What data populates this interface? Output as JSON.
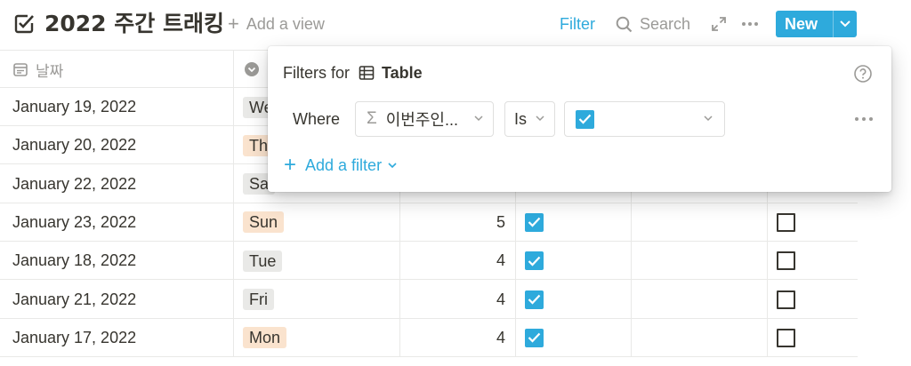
{
  "header": {
    "title": "2022 주간 트래킹",
    "add_view_label": "Add a view",
    "filter_label": "Filter",
    "search_label": "Search",
    "new_label": "New",
    "accent_color": "#2eaadc"
  },
  "table": {
    "columns": [
      {
        "label": "날짜",
        "icon": "calendar-icon"
      },
      {
        "label": "",
        "icon": "select-icon"
      }
    ],
    "rows": [
      {
        "date": "January 19, 2022",
        "day": "We",
        "day_color": "#e9e9e7",
        "count": "",
        "checked": null,
        "box": null
      },
      {
        "date": "January 20, 2022",
        "day": "Th",
        "day_color": "#fae3ce",
        "count": "",
        "checked": null,
        "box": null
      },
      {
        "date": "January 22, 2022",
        "day": "Sa",
        "day_color": "#e9e9e7",
        "count": "",
        "checked": null,
        "box": null
      },
      {
        "date": "January 23, 2022",
        "day": "Sun",
        "day_color": "#fae3ce",
        "count": "5",
        "checked": true,
        "box": false
      },
      {
        "date": "January 18, 2022",
        "day": "Tue",
        "day_color": "#e9e9e7",
        "count": "4",
        "checked": true,
        "box": false
      },
      {
        "date": "January 21, 2022",
        "day": "Fri",
        "day_color": "#e9e9e7",
        "count": "4",
        "checked": true,
        "box": false
      },
      {
        "date": "January 17, 2022",
        "day": "Mon",
        "day_color": "#fae3ce",
        "count": "4",
        "checked": true,
        "box": false
      }
    ]
  },
  "filter_popup": {
    "title_prefix": "Filters for",
    "table_name": "Table",
    "where_label": "Where",
    "property_label": "이번주인...",
    "operator_label": "Is",
    "value_checked": true,
    "add_filter_label": "Add a filter"
  }
}
